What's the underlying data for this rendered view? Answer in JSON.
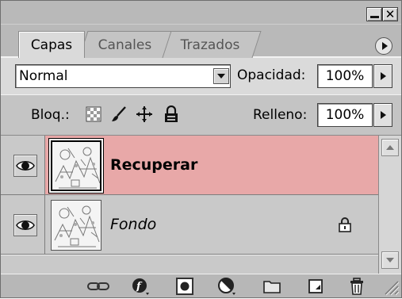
{
  "window": {
    "minimize_icon": "minimize-icon",
    "close_icon": "close-icon"
  },
  "tabs": [
    {
      "label": "Capas",
      "active": true
    },
    {
      "label": "Canales",
      "active": false
    },
    {
      "label": "Trazados",
      "active": false
    }
  ],
  "blend": {
    "mode": "Normal",
    "opacity_label": "Opacidad:",
    "opacity_value": "100%"
  },
  "locks": {
    "label": "Bloq.:",
    "icons": [
      "lock-transparent-pixels-icon",
      "lock-image-pixels-icon",
      "lock-position-icon",
      "lock-all-icon"
    ],
    "fill_label": "Relleno:",
    "fill_value": "100%"
  },
  "layers": [
    {
      "name": "Recuperar",
      "visible": true,
      "selected": true,
      "locked": false
    },
    {
      "name": "Fondo",
      "visible": true,
      "selected": false,
      "locked": true
    }
  ],
  "bottom_toolbar": {
    "icons": [
      "link-layers-icon",
      "layer-style-icon",
      "layer-mask-icon",
      "adjustment-layer-icon",
      "new-group-icon",
      "new-layer-icon",
      "trash-icon"
    ]
  },
  "colors": {
    "selected_layer": "#e8a8a8",
    "panel_bg": "#b5b5b5"
  }
}
